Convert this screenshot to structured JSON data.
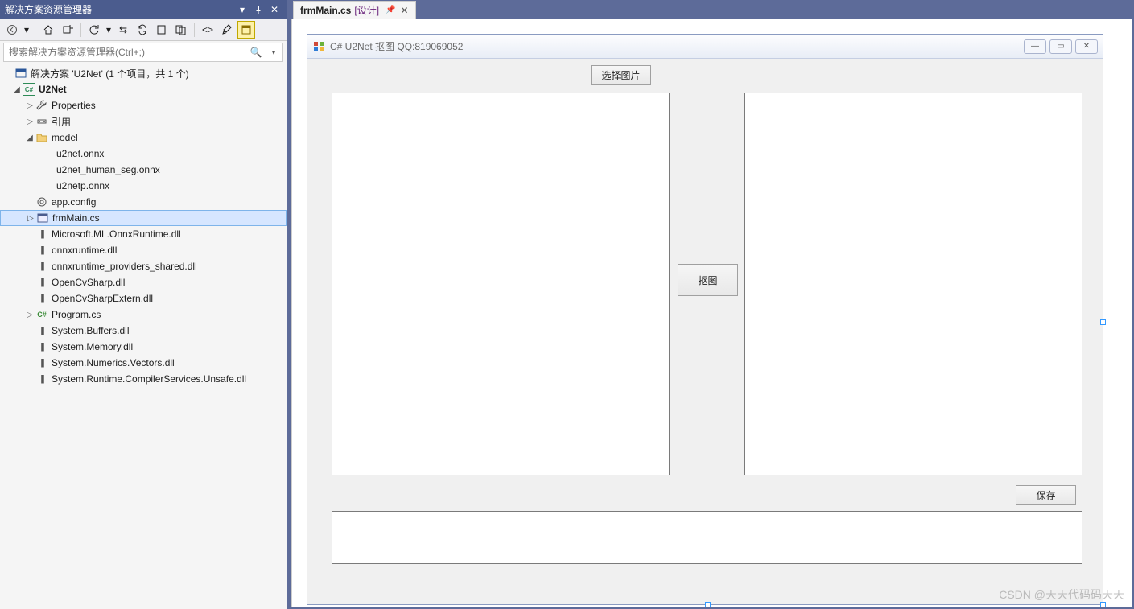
{
  "solutionExplorer": {
    "title": "解决方案资源管理器",
    "searchPlaceholder": "搜索解决方案资源管理器(Ctrl+;)",
    "solutionLabel": "解决方案 'U2Net' (1 个项目，共 1 个)",
    "projectName": "U2Net",
    "nodes": {
      "properties": "Properties",
      "references": "引用",
      "model": "model",
      "model_children": [
        "u2net.onnx",
        "u2net_human_seg.onnx",
        "u2netp.onnx"
      ],
      "appconfig": "app.config",
      "frmMain": "frmMain.cs",
      "dlls": [
        "Microsoft.ML.OnnxRuntime.dll",
        "onnxruntime.dll",
        "onnxruntime_providers_shared.dll",
        "OpenCvSharp.dll",
        "OpenCvSharpExtern.dll"
      ],
      "programcs": "Program.cs",
      "dlls2": [
        "System.Buffers.dll",
        "System.Memory.dll",
        "System.Numerics.Vectors.dll",
        "System.Runtime.CompilerServices.Unsafe.dll"
      ]
    }
  },
  "tabs": {
    "active": {
      "file": "frmMain.cs",
      "suffix": "[设计]"
    }
  },
  "form": {
    "title": "C# U2Net 抠图 QQ:819069052",
    "btnSelect": "选择图片",
    "btnMatting": "抠图",
    "btnSave": "保存"
  },
  "watermark": "CSDN @天天代码码天天"
}
